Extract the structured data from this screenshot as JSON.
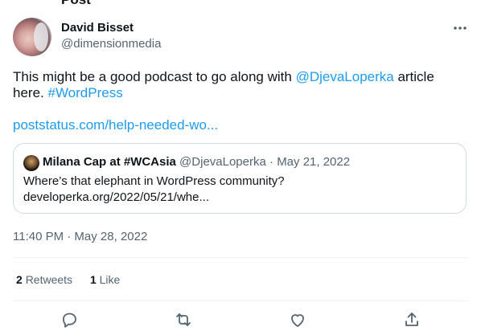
{
  "header_cut_text": "Post",
  "author": {
    "display_name": "David Bisset",
    "handle": "@dimensionmedia"
  },
  "tweet": {
    "text_before": "This might be a good podcast to go along with ",
    "mention": "@DjevaLoperka",
    "text_after": " article here. ",
    "hashtag": "#WordPress",
    "link": "poststatus.com/help-needed-wo..."
  },
  "quoted": {
    "display_name": "Milana Cap at #WCAsia",
    "handle": "@DjevaLoperka",
    "date": "May 21, 2022",
    "line1": "Where’s that elephant in WordPress community?",
    "line2": "developerka.org/2022/05/21/whe..."
  },
  "timestamp": "11:40 PM · May 28, 2022",
  "stats": {
    "retweets_count": "2",
    "retweets_label": "Retweets",
    "likes_count": "1",
    "likes_label": "Like"
  },
  "icons": {
    "more": "more-icon",
    "reply": "reply-icon",
    "retweet": "retweet-icon",
    "like": "heart-icon",
    "share": "share-icon"
  },
  "colors": {
    "link": "#1d9bf0",
    "secondary_text": "#536471",
    "border": "#cfd9de"
  }
}
